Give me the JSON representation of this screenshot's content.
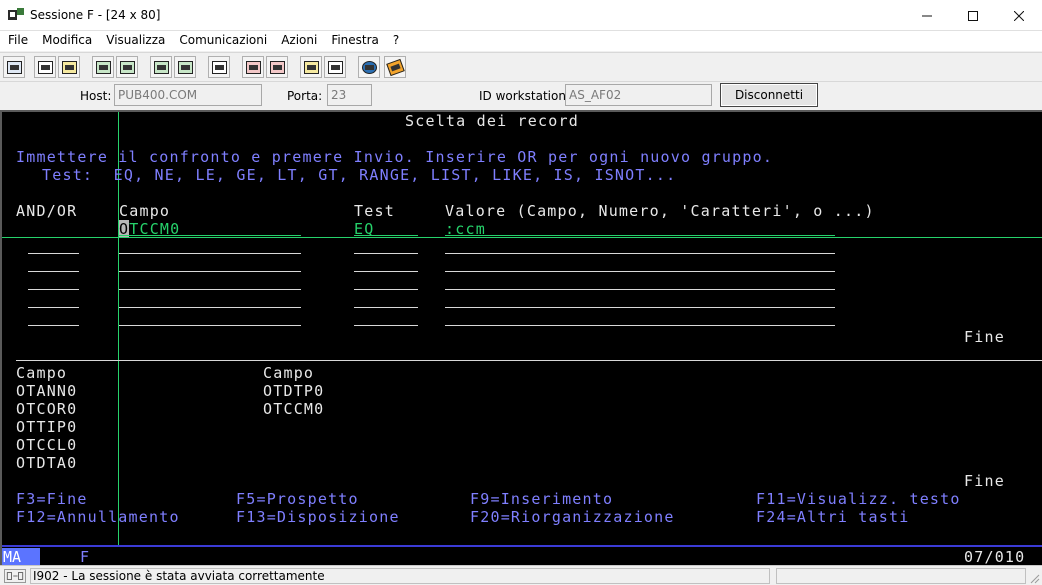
{
  "window": {
    "title": "Sessione F - [24 x 80]",
    "controls": {
      "minimize": "—",
      "maximize": "☐",
      "close": "✕"
    }
  },
  "menu": {
    "items": [
      {
        "label": "File"
      },
      {
        "label": "Modifica"
      },
      {
        "label": "Visualizza"
      },
      {
        "label": "Comunicazioni"
      },
      {
        "label": "Azioni"
      },
      {
        "label": "Finestra"
      },
      {
        "label": "?"
      }
    ]
  },
  "toolbar": {
    "icons": [
      "print-screen-icon",
      "copy-icon",
      "paste-icon",
      "send-icon",
      "receive-icon",
      "display-icon",
      "keypad-icon",
      "keyboard-icon",
      "macro-record-icon",
      "macro-stop-icon",
      "macro-play-icon",
      "macro-playback-icon",
      "globe-icon",
      "edit-note-icon"
    ]
  },
  "hostbar": {
    "host_label": "Host:",
    "host_value": "PUB400.COM",
    "port_label": "Porta:",
    "port_value": "23",
    "workstation_label": "ID workstation:",
    "workstation_value": "AS_AF02",
    "disconnect_label": "Disconnetti"
  },
  "terminal": {
    "title": "Scelta dei record",
    "instructions1": "Immettere il confronto e premere Invio. Inserire OR per ogni nuovo gruppo.",
    "instructions2": "Test:  EQ, NE, LE, GE, LT, GT, RANGE, LIST, LIKE, IS, ISNOT...",
    "col_andor": "AND/OR",
    "col_campo": "Campo",
    "col_test": "Test",
    "col_valore": "Valore (Campo, Numero, 'Caratteri', o ...)",
    "row1_campo_cursor": "O",
    "row1_campo_rest": "TCCM0",
    "row1_test": "EQ",
    "row1_valore": ":ccm",
    "fine1": "Fine",
    "list_header_left": "Campo",
    "list_header_right": "Campo",
    "fields_left": [
      "OTANN0",
      "OTCOR0",
      "OTTIP0",
      "OTCCL0",
      "OTDTA0"
    ],
    "fields_right": [
      "OTDTP0",
      "OTCCM0"
    ],
    "fine2": "Fine",
    "fkeys_row1": [
      "F3=Fine",
      "F5=Prospetto",
      "F9=Inserimento",
      "F11=Visualizz. testo"
    ],
    "fkeys_row2": [
      "F12=Annullamento",
      "F13=Disposizione",
      "F20=Riorganizzazione",
      "F24=Altri tasti"
    ],
    "status_ma": "MA",
    "status_session": "F",
    "status_pos": "07/010"
  },
  "statusbar": {
    "message": "I902 - La sessione è stata avviata correttamente"
  }
}
